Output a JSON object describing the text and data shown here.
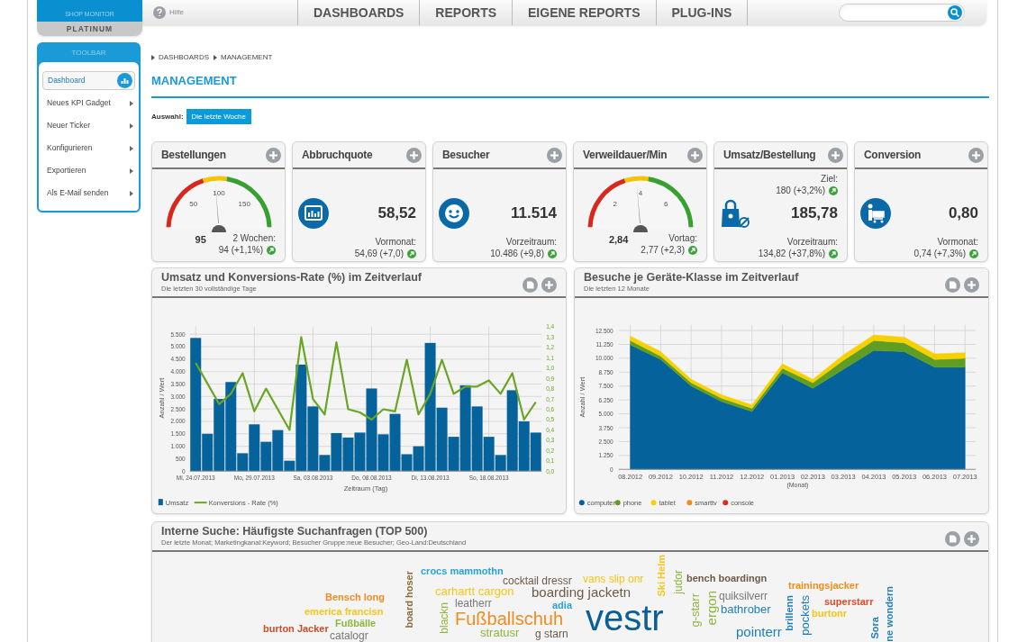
{
  "header": {
    "logo_top": "SHOP MONITOR",
    "logo_edition": "PLATINUM",
    "help": "Hilfe",
    "nav": [
      "DASHBOARDS",
      "REPORTS",
      "EIGENE REPORTS",
      "PLUG-INS"
    ]
  },
  "toolbar": {
    "title": "TOOLBAR",
    "items": [
      {
        "label": "Dashboard",
        "selected": true,
        "submenu": false
      },
      {
        "label": "Neues KPI Gadget",
        "selected": false,
        "submenu": true
      },
      {
        "label": "Neuer Ticker",
        "selected": false,
        "submenu": true
      },
      {
        "label": "Konfigurieren",
        "selected": false,
        "submenu": true
      },
      {
        "label": "Exportieren",
        "selected": false,
        "submenu": true
      },
      {
        "label": "Als E-Mail senden",
        "selected": false,
        "submenu": true
      }
    ]
  },
  "breadcrumb": [
    "DASHBOARDS",
    "MANAGEMENT"
  ],
  "title": "MANAGEMENT",
  "filter": {
    "label": "Auswahl:",
    "value": "Die letzte Woche"
  },
  "kpis": [
    {
      "title": "Bestellungen",
      "kind": "gauge",
      "ticks": [
        "50",
        "100",
        "150"
      ],
      "level": 0.475,
      "value": "95",
      "compare_label": "2 Wochen:",
      "compare": "94 (+1,1%)"
    },
    {
      "title": "Abbruchquote",
      "kind": "chart",
      "value": "58,52",
      "compare_label": "Vormonat:",
      "compare": "54,69 (+7,0)"
    },
    {
      "title": "Besucher",
      "kind": "smiley",
      "value": "11.514",
      "compare_label": "Vorzeitraum:",
      "compare": "10.486 (+9,8)"
    },
    {
      "title": "Verweildauer/Min",
      "kind": "gauge",
      "ticks": [
        "2",
        "4",
        "6"
      ],
      "level": 0.473,
      "value": "2,84",
      "compare_label": "Vortag:",
      "compare": "2,77 (+2,3)"
    },
    {
      "title": "Umsatz/Bestellung",
      "kind": "bag",
      "goal_label": "Ziel:",
      "goal": "180 (+3,2%)",
      "value": "185,78",
      "compare_label": "Vorzeitraum:",
      "compare": "134,82 (+37,8%)"
    },
    {
      "title": "Conversion",
      "kind": "cart",
      "value": "0,80",
      "compare_label": "Vormonat:",
      "compare": "0,74 (+7,3%)"
    }
  ],
  "charts": [
    {
      "title": "Umsatz und Konversions-Rate (%) im Zeitverlauf",
      "subtitle": "Die letzten 30 vollständige Tage",
      "chart_data": {
        "type": "bar",
        "xlabel": "Zeitraum (Tag)",
        "ylabel": "Anzahl / Wert",
        "grid": true,
        "legend": "lower left",
        "categories": [
          "Mi, 24.07.2013",
          null,
          null,
          null,
          null,
          "Mo, 29.07.2013",
          null,
          null,
          null,
          null,
          "Sa, 03.08.2013",
          null,
          null,
          null,
          null,
          "Do, 08.08.2013",
          null,
          null,
          null,
          null,
          "Di, 13.08.2013",
          null,
          null,
          null,
          null,
          "So, 18.08.2013",
          null,
          null,
          null,
          null
        ],
        "ylim": [
          0,
          5800
        ],
        "y2lim": [
          0,
          1.4
        ],
        "yticks": [
          {
            "value": 0,
            "label": "0"
          },
          {
            "value": 500,
            "label": "500"
          },
          {
            "value": 1000,
            "label": "1.000"
          },
          {
            "value": 1500,
            "label": "1.500"
          },
          {
            "value": 2000,
            "label": "2.000"
          },
          {
            "value": 2500,
            "label": "2.500"
          },
          {
            "value": 3000,
            "label": "3.000"
          },
          {
            "value": 3500,
            "label": "3.500"
          },
          {
            "value": 4000,
            "label": "4.000"
          },
          {
            "value": 4500,
            "label": "4.500"
          },
          {
            "value": 5000,
            "label": "5.000"
          },
          {
            "value": 5500,
            "label": "5.500"
          }
        ],
        "y2ticks": [
          {
            "value": 0,
            "label": "0,0"
          },
          {
            "value": 0.1,
            "label": "0,1"
          },
          {
            "value": 0.2,
            "label": "0,2"
          },
          {
            "value": 0.3,
            "label": "0,3"
          },
          {
            "value": 0.4,
            "label": "0,4"
          },
          {
            "value": 0.5,
            "label": "0,5"
          },
          {
            "value": 0.6,
            "label": "0,6"
          },
          {
            "value": 0.7,
            "label": "0,7"
          },
          {
            "value": 0.8,
            "label": "0,8"
          },
          {
            "value": 0.9,
            "label": "0,9"
          },
          {
            "value": 1.0,
            "label": "1,0"
          },
          {
            "value": 1.1,
            "label": "1,1"
          },
          {
            "value": 1.2,
            "label": "1,2"
          },
          {
            "value": 1.3,
            "label": "1,3"
          },
          {
            "value": 1.4,
            "label": "1,4"
          }
        ],
        "series": [
          {
            "name": "Umsatz",
            "type": "bar",
            "color": "#05629a",
            "values": [
              5350,
              1500,
              2900,
              3580,
              720,
              1880,
              1180,
              1650,
              420,
              4280,
              2600,
              650,
              1530,
              1350,
              1550,
              3320,
              1480,
              2300,
              680,
              1000,
              5150,
              2550,
              1380,
              3450,
              2600,
              1380,
              650,
              3250,
              2000,
              1550
            ]
          },
          {
            "name": "Konversions - Rate (%)",
            "type": "line",
            "axis": "y2",
            "color": "#6aa524",
            "values": [
              1.05,
              0.85,
              0.65,
              0.75,
              0.95,
              0.58,
              0.8,
              0.6,
              0.4,
              1.3,
              0.7,
              0.55,
              1.25,
              0.6,
              0.57,
              0.5,
              0.6,
              0.58,
              1.08,
              0.55,
              0.75,
              1.08,
              0.75,
              0.82,
              0.82,
              0.88,
              0.75,
              0.95,
              0.5,
              0.67
            ]
          }
        ]
      }
    },
    {
      "title": "Besuche je Geräte-Klasse im Zeitverlauf",
      "subtitle": "Die letzten 12 Monate",
      "chart_data": {
        "type": "area",
        "stacked": true,
        "xlabel": "(Monat)",
        "ylabel": "Anzahl / Wert",
        "grid": true,
        "legend": "lower left",
        "ylim": [
          0,
          13000
        ],
        "categories": [
          "08.2012",
          "09.2012",
          "10.2012",
          "11.2012",
          "12.2012",
          "01.2013",
          "02.2013",
          "03.2013",
          "04.2013",
          "05.2013",
          "06.2013",
          "07.2013"
        ],
        "yticks": [
          {
            "value": 0,
            "label": "0"
          },
          {
            "value": 1250,
            "label": "1.250"
          },
          {
            "value": 2500,
            "label": "2.500"
          },
          {
            "value": 3750,
            "label": "3.750"
          },
          {
            "value": 5000,
            "label": "5.000"
          },
          {
            "value": 6250,
            "label": "6.250"
          },
          {
            "value": 7500,
            "label": "7.500"
          },
          {
            "value": 8750,
            "label": "8.750"
          },
          {
            "value": 10000,
            "label": "10.000"
          },
          {
            "value": 11250,
            "label": "11.250"
          },
          {
            "value": 12500,
            "label": "12.500"
          }
        ],
        "series": [
          {
            "name": "computer",
            "color": "#05629a",
            "values": [
              11200,
              9900,
              7500,
              6100,
              5200,
              8700,
              7300,
              9000,
              10700,
              10600,
              9200,
              9200
            ]
          },
          {
            "name": "phone",
            "color": "#5f9e25",
            "values": [
              400,
              300,
              300,
              300,
              300,
              400,
              500,
              800,
              900,
              800,
              700,
              800
            ]
          },
          {
            "name": "tablet",
            "color": "#f7d000",
            "values": [
              400,
              400,
              300,
              300,
              300,
              400,
              300,
              500,
              500,
              500,
              500,
              500
            ]
          },
          {
            "name": "smarttv",
            "color": "#f08c1e",
            "values": [
              null,
              null,
              null,
              null,
              null,
              null,
              null,
              null,
              null,
              null,
              null,
              null
            ]
          },
          {
            "name": "console",
            "color": "#e02a1a",
            "values": [
              null,
              null,
              null,
              null,
              null,
              null,
              null,
              null,
              null,
              null,
              null,
              null
            ]
          }
        ]
      }
    }
  ],
  "cloud": {
    "title": "Interne Suche: Häufigste Suchanfragen (TOP 500)",
    "subtitle": "Der letzte Monat; Marketingkanal:Keyword; Besucher Gruppe:neue Besucher; Geo-Land:Deutschland",
    "words": [
      {
        "text": "crocs mammothn",
        "color": "#29a3d6",
        "vertical": false
      },
      {
        "text": "Ski Helm",
        "color": "#f5c518",
        "vertical": true
      },
      {
        "text": "board hoser",
        "color": "#8a6a3a",
        "vertical": true
      },
      {
        "text": "cocktail dressr",
        "color": "#6b5a4a",
        "vertical": false
      },
      {
        "text": "vans slip onr",
        "color": "#f5c518",
        "vertical": false
      },
      {
        "text": "judor",
        "color": "#8cb63c",
        "vertical": true
      },
      {
        "text": "bench boardingn",
        "color": "#6b5a4a",
        "vertical": false
      },
      {
        "text": "carhartt cargon",
        "color": "#f5c518",
        "vertical": false
      },
      {
        "text": "boarding jacketn",
        "color": "#6b5a4a",
        "vertical": false
      },
      {
        "text": "trainingsjacker",
        "color": "#f08c1e",
        "vertical": false
      },
      {
        "text": "ne wondern",
        "color": "#1e7fb8",
        "vertical": true
      },
      {
        "text": "Bensch long",
        "color": "#f08c1e",
        "vertical": false
      },
      {
        "text": "leatherr",
        "color": "#777777",
        "vertical": false
      },
      {
        "text": "g-starr",
        "color": "#8cb63c",
        "vertical": true
      },
      {
        "text": "ergon",
        "color": "#8cb63c",
        "vertical": true
      },
      {
        "text": "quiksilverr",
        "color": "#777777",
        "vertical": false
      },
      {
        "text": "brillenn",
        "color": "#1e7fb8",
        "vertical": true
      },
      {
        "text": "pockets",
        "color": "#1e7fb8",
        "vertical": true
      },
      {
        "text": "blackn",
        "color": "#8cb63c",
        "vertical": true
      },
      {
        "text": "adia",
        "color": "#29a3d6",
        "vertical": false
      },
      {
        "text": "vestr",
        "color": "#0a5f96",
        "vertical": false
      },
      {
        "text": "bathrober",
        "color": "#1e7fb8",
        "vertical": false
      },
      {
        "text": "superstarr",
        "color": "#e04a2a",
        "vertical": false
      },
      {
        "text": "emerica francisn",
        "color": "#f5c518",
        "vertical": false
      },
      {
        "text": "Fußballschuh",
        "color": "#f08c1e",
        "vertical": false
      },
      {
        "text": "burtonr",
        "color": "#f5c518",
        "vertical": false
      },
      {
        "text": "Fußbälle",
        "color": "#8cb63c",
        "vertical": false
      },
      {
        "text": "Sora",
        "color": "#1e7fb8",
        "vertical": true
      },
      {
        "text": "burton Jacker",
        "color": "#c2502a",
        "vertical": false
      },
      {
        "text": "catalogr",
        "color": "#777777",
        "vertical": false
      },
      {
        "text": "stratusr",
        "color": "#8cb63c",
        "vertical": false
      },
      {
        "text": "g starn",
        "color": "#6b5a4a",
        "vertical": false
      },
      {
        "text": "pointerr",
        "color": "#1e7fb8",
        "vertical": false
      }
    ]
  }
}
